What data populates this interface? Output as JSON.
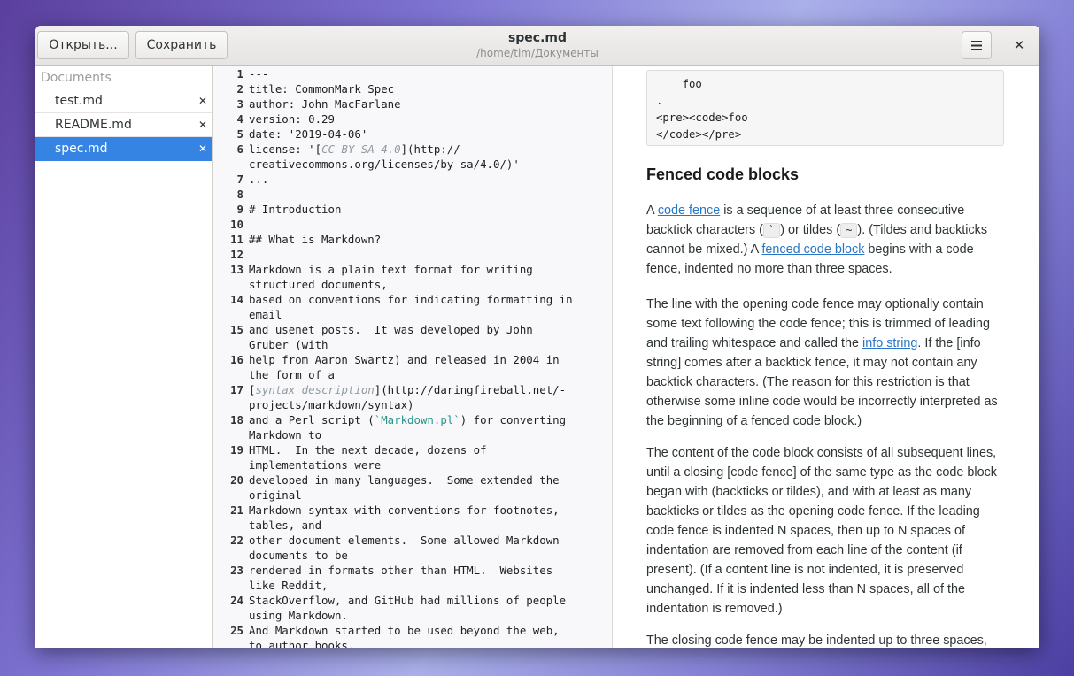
{
  "window": {
    "title": "spec.md",
    "subtitle": "/home/tim/Документы"
  },
  "header": {
    "open_label": "Открыть...",
    "save_label": "Сохранить",
    "menu_icon": "hamburger-menu-icon",
    "close_glyph": "✕"
  },
  "sidebar": {
    "heading": "Documents",
    "items": [
      {
        "label": "test.md",
        "active": false,
        "close": "✕"
      },
      {
        "label": "README.md",
        "active": false,
        "close": "✕"
      },
      {
        "label": "spec.md",
        "active": true,
        "close": "✕"
      }
    ]
  },
  "editor": {
    "lines": [
      {
        "n": "1",
        "segments": [
          {
            "t": "---"
          }
        ]
      },
      {
        "n": "2",
        "segments": [
          {
            "t": "title: CommonMark Spec"
          }
        ]
      },
      {
        "n": "3",
        "segments": [
          {
            "t": "author: John MacFarlane"
          }
        ]
      },
      {
        "n": "4",
        "segments": [
          {
            "t": "version: 0.29"
          }
        ]
      },
      {
        "n": "5",
        "segments": [
          {
            "t": "date: '2019-04-06'"
          }
        ]
      },
      {
        "n": "6",
        "segments": [
          {
            "t": "license: '["
          },
          {
            "t": "CC-BY-SA 4.0",
            "s": "ital"
          },
          {
            "t": "](http://-"
          }
        ]
      },
      {
        "n": "",
        "segments": [
          {
            "t": "creativecommons.org/licenses/by-sa/4.0/)'"
          }
        ]
      },
      {
        "n": "7",
        "segments": [
          {
            "t": "..."
          }
        ]
      },
      {
        "n": "8",
        "segments": [
          {
            "t": ""
          }
        ]
      },
      {
        "n": "9",
        "segments": [
          {
            "t": "# Introduction"
          }
        ]
      },
      {
        "n": "10",
        "segments": [
          {
            "t": ""
          }
        ]
      },
      {
        "n": "11",
        "segments": [
          {
            "t": "## What is Markdown?"
          }
        ]
      },
      {
        "n": "12",
        "segments": [
          {
            "t": ""
          }
        ]
      },
      {
        "n": "13",
        "segments": [
          {
            "t": "Markdown is a plain text format for writing"
          }
        ]
      },
      {
        "n": "",
        "segments": [
          {
            "t": "structured documents,"
          }
        ]
      },
      {
        "n": "14",
        "segments": [
          {
            "t": "based on conventions for indicating formatting in"
          }
        ]
      },
      {
        "n": "",
        "segments": [
          {
            "t": "email"
          }
        ]
      },
      {
        "n": "15",
        "segments": [
          {
            "t": "and usenet posts.  It was developed by John"
          }
        ]
      },
      {
        "n": "",
        "segments": [
          {
            "t": "Gruber (with"
          }
        ]
      },
      {
        "n": "16",
        "segments": [
          {
            "t": "help from Aaron Swartz) and released in 2004 in"
          }
        ]
      },
      {
        "n": "",
        "segments": [
          {
            "t": "the form of a"
          }
        ]
      },
      {
        "n": "17",
        "segments": [
          {
            "t": "["
          },
          {
            "t": "syntax description",
            "s": "ital"
          },
          {
            "t": "](http://daringfireball.net/-"
          }
        ]
      },
      {
        "n": "",
        "segments": [
          {
            "t": "projects/markdown/syntax)"
          }
        ]
      },
      {
        "n": "18",
        "segments": [
          {
            "t": "and a Perl script ("
          },
          {
            "t": "`Markdown.pl`",
            "s": "tealcode"
          },
          {
            "t": ") for converting"
          }
        ]
      },
      {
        "n": "",
        "segments": [
          {
            "t": "Markdown to"
          }
        ]
      },
      {
        "n": "19",
        "segments": [
          {
            "t": "HTML.  In the next decade, dozens of"
          }
        ]
      },
      {
        "n": "",
        "segments": [
          {
            "t": "implementations were"
          }
        ]
      },
      {
        "n": "20",
        "segments": [
          {
            "t": "developed in many languages.  Some extended the"
          }
        ]
      },
      {
        "n": "",
        "segments": [
          {
            "t": "original"
          }
        ]
      },
      {
        "n": "21",
        "segments": [
          {
            "t": "Markdown syntax with conventions for footnotes,"
          }
        ]
      },
      {
        "n": "",
        "segments": [
          {
            "t": "tables, and"
          }
        ]
      },
      {
        "n": "22",
        "segments": [
          {
            "t": "other document elements.  Some allowed Markdown"
          }
        ]
      },
      {
        "n": "",
        "segments": [
          {
            "t": "documents to be"
          }
        ]
      },
      {
        "n": "23",
        "segments": [
          {
            "t": "rendered in formats other than HTML.  Websites"
          }
        ]
      },
      {
        "n": "",
        "segments": [
          {
            "t": "like Reddit,"
          }
        ]
      },
      {
        "n": "24",
        "segments": [
          {
            "t": "StackOverflow, and GitHub had millions of people"
          }
        ]
      },
      {
        "n": "",
        "segments": [
          {
            "t": "using Markdown."
          }
        ]
      },
      {
        "n": "25",
        "segments": [
          {
            "t": "And Markdown started to be used beyond the web,"
          }
        ]
      },
      {
        "n": "",
        "segments": [
          {
            "t": "to author books,"
          }
        ]
      }
    ]
  },
  "preview": {
    "code_lines": [
      "    foo",
      ".",
      "<pre><code>foo",
      "</code></pre>"
    ],
    "heading": "Fenced code blocks",
    "p1": {
      "a": "A ",
      "link1": "code fence",
      "b": " is a sequence of at least three consecutive backtick characters (",
      "code1": "`",
      "c": ") or tildes (",
      "code2": "~",
      "d": "). (Tildes and backticks cannot be mixed.) A ",
      "link2": "fenced code block",
      "e": " begins with a code fence, indented no more than three spaces."
    },
    "p2": {
      "a": "The line with the opening code fence may optionally contain some text following the code fence; this is trimmed of leading and trailing whitespace and called the ",
      "link": "info string",
      "b": ". If the [info string] comes after a backtick fence, it may not contain any backtick characters. (The reason for this restriction is that otherwise some inline code would be incorrectly interpreted as the beginning of a fenced code block.)"
    },
    "p3": "The content of the code block consists of all subsequent lines, until a closing [code fence] of the same type as the code block began with (backticks or tildes), and with at least as many backticks or tildes as the opening code fence. If the leading code fence is indented N spaces, then up to N spaces of indentation are removed from each line of the content (if present). (If a content line is not indented, it is preserved unchanged. If it is indented less than N spaces, all of the indentation is removed.)",
    "p4": "The closing code fence may be indented up to three spaces,"
  }
}
